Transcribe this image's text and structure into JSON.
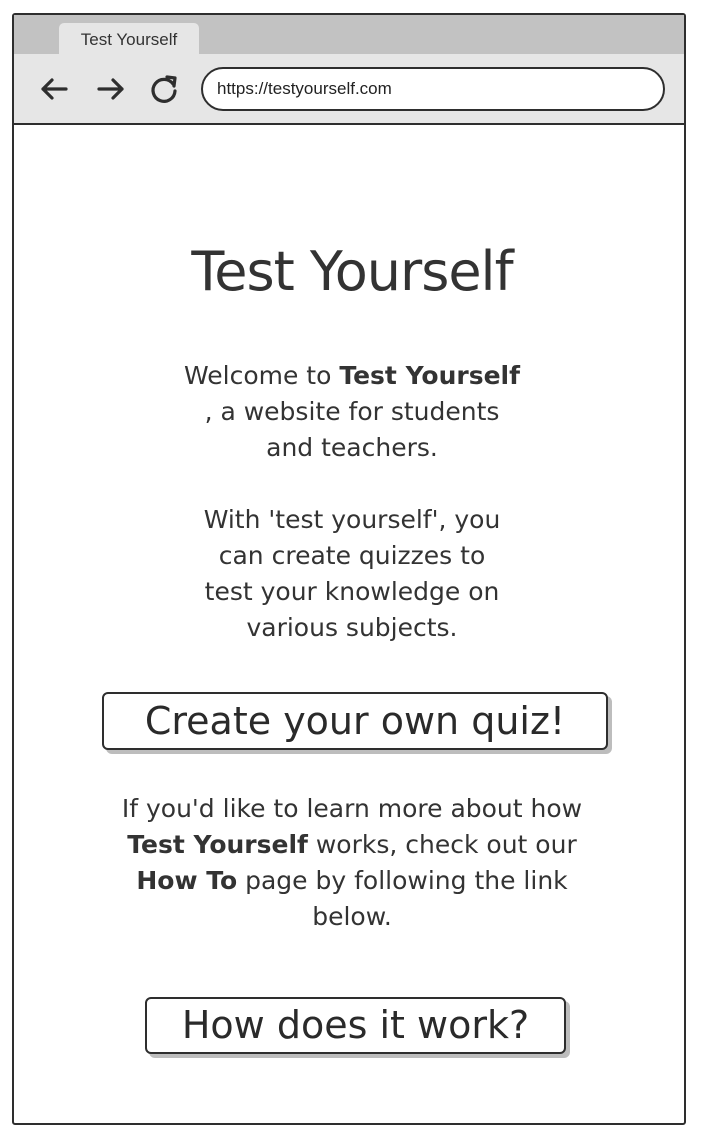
{
  "browser": {
    "tab_title": "Test Yourself",
    "url": "https://testyourself.com",
    "icons": [
      "back-arrow-icon",
      "forward-arrow-icon",
      "reload-icon"
    ]
  },
  "page": {
    "title": "Test Yourself",
    "welcome": {
      "line1_prefix": "Welcome to ",
      "line1_bold": "Test Yourself",
      "line2": ", a website for students",
      "line3": "and teachers."
    },
    "description": {
      "line1": "With 'test yourself', you",
      "line2": "can create quizzes to",
      "line3": "test your knowledge on",
      "line4": "various subjects."
    },
    "create_button": "Create your own quiz!",
    "learn_more": {
      "line1": "If you'd like to learn more about how",
      "line2_bold": "Test Yourself",
      "line2_rest": " works, check out our",
      "line3_bold": "How To",
      "line3_rest": " page by following the link",
      "line4": "below."
    },
    "how_button": "How does it work?"
  },
  "colors": {
    "stroke": "#2e2e2e",
    "text": "#333333",
    "chrome": "#e6e6e6",
    "tabstrip": "#c2c2c2",
    "button_shadow": "#bdbdbd"
  }
}
